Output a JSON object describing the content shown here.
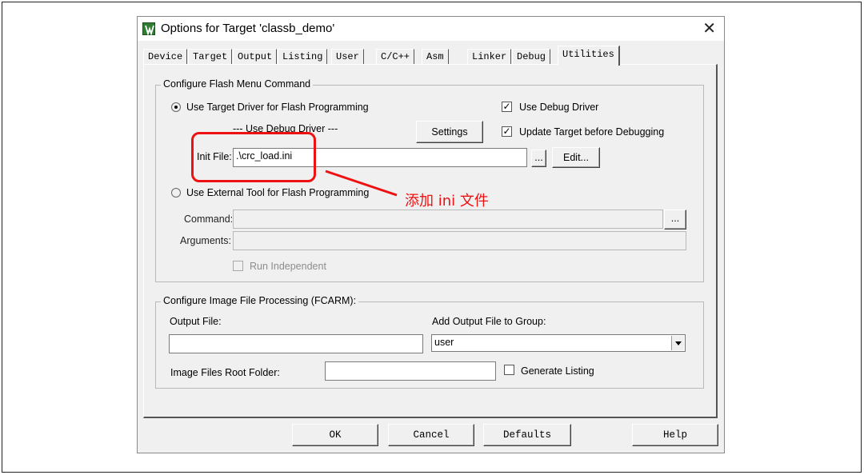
{
  "dialog": {
    "title": "Options for Target 'classb_demo'",
    "close_glyph": "✕",
    "tabs": [
      {
        "label": "Device"
      },
      {
        "label": "Target"
      },
      {
        "label": "Output"
      },
      {
        "label": "Listing"
      },
      {
        "label": "User"
      },
      {
        "label": "C/C++"
      },
      {
        "label": "Asm"
      },
      {
        "label": "Linker"
      },
      {
        "label": "Debug"
      },
      {
        "label": "Utilities"
      }
    ],
    "active_tab": "Utilities"
  },
  "flash": {
    "group_title": "Configure Flash Menu Command",
    "use_target_driver_label": "Use Target Driver for Flash Programming",
    "driver_caption": "--- Use Debug Driver ---",
    "settings_label": "Settings",
    "use_debug_driver_label": "Use Debug Driver",
    "use_debug_driver_checked": true,
    "update_target_label": "Update Target before Debugging",
    "update_target_checked": true,
    "init_file_label": "Init File:",
    "init_file_value": ".\\crc_load.ini",
    "browse_label": "...",
    "edit_label": "Edit...",
    "use_external_label": "Use External Tool for Flash Programming",
    "command_label": "Command:",
    "command_value": "",
    "command_browse_label": "...",
    "arguments_label": "Arguments:",
    "arguments_value": "",
    "run_independent_label": "Run Independent",
    "check_mark": "✓"
  },
  "image": {
    "group_title": "Configure Image File Processing (FCARM):",
    "output_file_label": "Output File:",
    "output_file_value": "",
    "add_output_label": "Add Output File  to Group:",
    "group_value": "user",
    "root_folder_label": "Image Files Root Folder:",
    "root_folder_value": "",
    "generate_listing_label": "Generate Listing"
  },
  "footer": {
    "ok_label": "OK",
    "cancel_label": "Cancel",
    "defaults_label": "Defaults",
    "help_label": "Help"
  },
  "annotation": {
    "text": "添加 ini 文件",
    "color": "#ee1111"
  }
}
